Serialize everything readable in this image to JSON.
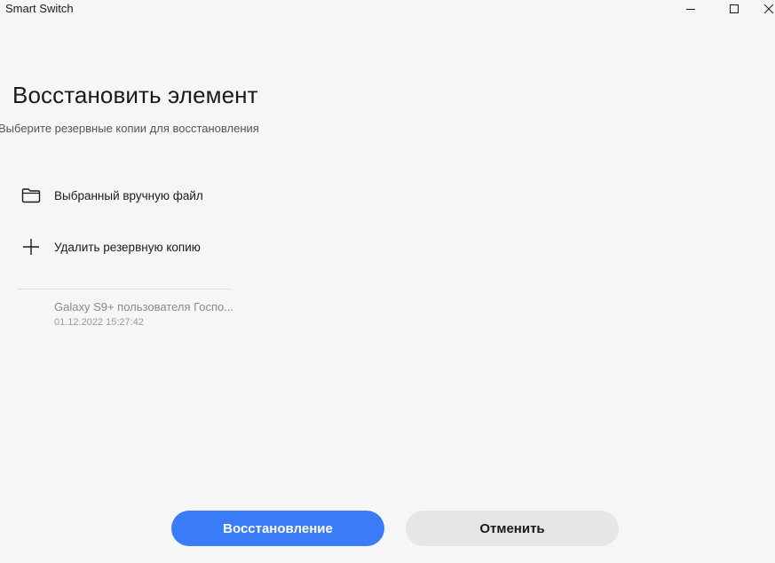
{
  "window": {
    "title": "Smart Switch",
    "controls": {
      "minimize_icon": "minimize-icon",
      "maximize_icon": "maximize-icon",
      "close_icon": "close-icon"
    }
  },
  "main": {
    "title": "Восстановить элемент",
    "subtitle": "Выберите резервные копии для восстановления",
    "options": [
      {
        "icon": "folder-icon",
        "label": "Выбранный вручную файл"
      },
      {
        "icon": "plus-icon",
        "label": "Удалить резервную копию"
      }
    ],
    "backups": [
      {
        "name": "Galaxy S9+ пользователя Госпо...",
        "date": "01.12.2022 15:27:42"
      }
    ]
  },
  "footer": {
    "restore_label": "Восстановление",
    "cancel_label": "Отменить"
  },
  "colors": {
    "background": "#f6f6f6",
    "primary": "#3a7bf7",
    "secondary_button": "#e6e6e6",
    "muted_text": "#8a8a8a"
  }
}
